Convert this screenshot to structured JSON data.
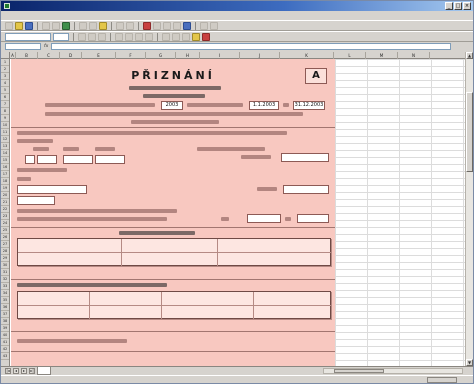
{
  "window": {
    "title": ""
  },
  "menu": {
    "items": [
      "",
      "",
      "",
      "",
      "",
      "",
      "",
      "",
      "",
      "",
      ""
    ]
  },
  "toolbar": {
    "font_name": "",
    "font_size": ""
  },
  "columns": [
    "A",
    "B",
    "C",
    "D",
    "E",
    "F",
    "G",
    "H",
    "I",
    "J",
    "K",
    "L",
    "M",
    "N"
  ],
  "rows": [
    "1",
    "2",
    "3",
    "4",
    "5",
    "6",
    "7",
    "8",
    "9",
    "10",
    "11",
    "12",
    "13",
    "14",
    "15",
    "16",
    "17",
    "18",
    "19",
    "20",
    "21",
    "22",
    "23",
    "24",
    "25",
    "26",
    "27",
    "28",
    "29",
    "30",
    "31",
    "32",
    "33",
    "34",
    "35",
    "36",
    "37",
    "38",
    "39",
    "40",
    "41",
    "42",
    "43"
  ],
  "form": {
    "title": "PŘIZNÁNÍ",
    "type_letter": "A",
    "year": "2003",
    "period_from": "1.1.2003",
    "period_to": "31.12.2003"
  },
  "tabs": {
    "sheets": [
      ""
    ]
  },
  "status": {
    "text": ""
  }
}
